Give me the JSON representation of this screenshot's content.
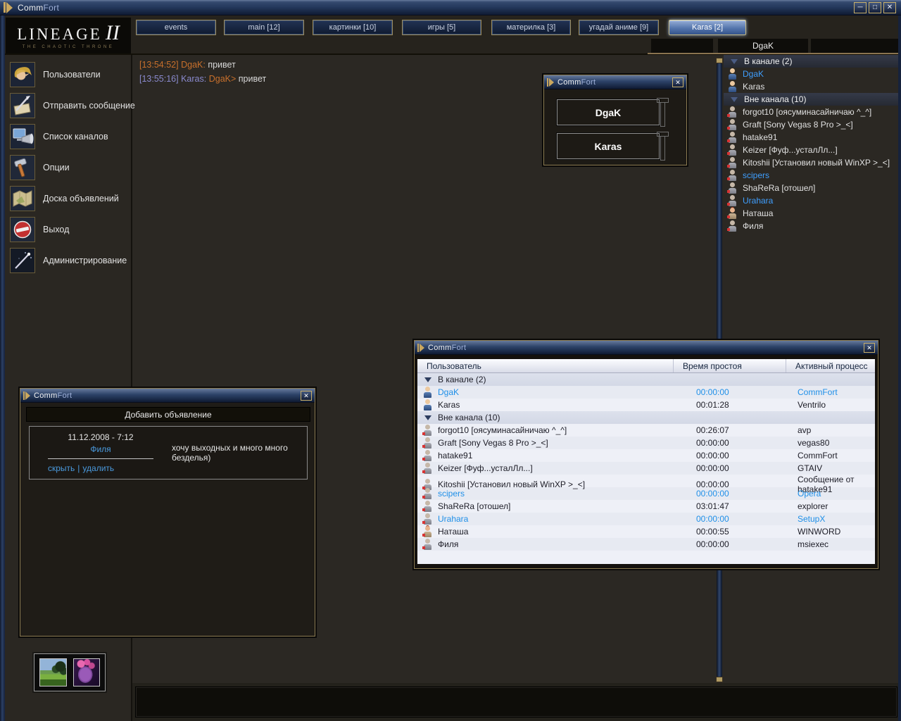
{
  "colors": {
    "accent_gold": "#b09a62",
    "titlebar_blue": "#24385c",
    "active_tab_blue": "#5576ad",
    "link_blue": "#4a9ade",
    "highlight_user_blue": "#3f9fff",
    "chat_orange": "#c8702c",
    "chat_violet": "#8a8ace",
    "table_bg": "#eef0f7"
  },
  "icons": {
    "minimize_glyph": "─",
    "maximize_glyph": "□",
    "close_glyph": "✕"
  },
  "titlebar": {
    "title_comm": "Comm",
    "title_fort": "Fort"
  },
  "logo": {
    "name": "LINEAGE",
    "numeral": "II",
    "subtitle": "THE CHAOTIC THRONE"
  },
  "tabs": [
    {
      "label": "events"
    },
    {
      "label": "main [12]"
    },
    {
      "label": "картинки [10]"
    },
    {
      "label": "игры [5]"
    },
    {
      "label": "материлка [3]"
    },
    {
      "label": "угадай аниме [9]"
    },
    {
      "label": "Karas [2]"
    }
  ],
  "user_header": {
    "current_user": "DgaK"
  },
  "sidebar": [
    {
      "label": "Пользователи",
      "icon": "users-icon"
    },
    {
      "label": "Отправить сообщение",
      "icon": "send-message-icon"
    },
    {
      "label": "Список каналов",
      "icon": "channel-list-icon"
    },
    {
      "label": "Опции",
      "icon": "options-icon"
    },
    {
      "label": "Доска объявлений",
      "icon": "bulletin-board-icon"
    },
    {
      "label": "Выход",
      "icon": "exit-icon"
    },
    {
      "label": "Администрирование",
      "icon": "administration-icon"
    }
  ],
  "chat": {
    "messages": [
      {
        "time": "[13:54:52]",
        "author": "DgaK:",
        "text": "привет"
      },
      {
        "time": "[13:55:16]",
        "author": "Karas:",
        "recipient": "DgaK>",
        "text": "привет"
      }
    ]
  },
  "userlist": {
    "items": [
      {
        "name": "В канале (2)",
        "type": "group"
      },
      {
        "name": "DgaK",
        "type": "user",
        "online": true,
        "highlight": true
      },
      {
        "name": "Karas",
        "type": "user",
        "online": true
      },
      {
        "name": "Вне канала (10)",
        "type": "group"
      },
      {
        "name": "forgot10 [оясуминасайничаю ^_^]",
        "type": "user"
      },
      {
        "name": "Graft [Sony Vegas 8 Pro >_<]",
        "type": "user"
      },
      {
        "name": "hatake91",
        "type": "user"
      },
      {
        "name": "Keizer [Фуф...усталЛл...]",
        "type": "user"
      },
      {
        "name": "Kitoshii [Установил новый WinXP >_<]",
        "type": "user"
      },
      {
        "name": "scipers",
        "type": "user",
        "highlight": true
      },
      {
        "name": "ShaReRa [отошел]",
        "type": "user"
      },
      {
        "name": "Urahara",
        "type": "user",
        "highlight": true
      },
      {
        "name": "Наташа",
        "type": "user",
        "female": true
      },
      {
        "name": "Филя",
        "type": "user"
      }
    ]
  },
  "process_window": {
    "columns": [
      "Пользователь",
      "Время простоя",
      "Активный процесс"
    ],
    "rows": [
      {
        "name": "В канале (2)",
        "idle": "",
        "process": "",
        "type": "group"
      },
      {
        "name": "DgaK",
        "idle": "00:00:00",
        "process": "CommFort",
        "highlight": true
      },
      {
        "name": "Karas",
        "idle": "00:01:28",
        "process": "Ventrilo"
      },
      {
        "name": "Вне канала (10)",
        "idle": "",
        "process": "",
        "type": "group"
      },
      {
        "name": "forgot10 [оясуминасайничаю ^_^]",
        "idle": "00:26:07",
        "process": "avp"
      },
      {
        "name": "Graft [Sony Vegas 8 Pro >_<]",
        "idle": "00:00:00",
        "process": "vegas80"
      },
      {
        "name": "hatake91",
        "idle": "00:00:00",
        "process": "CommFort"
      },
      {
        "name": "Keizer [Фуф...усталЛл...]",
        "idle": "00:00:00",
        "process": "GTAIV"
      },
      {
        "name": "Kitoshii [Установил новый WinXP >_<]",
        "idle": "00:00:00",
        "process": "Сообщение от hatake91"
      },
      {
        "name": "scipers",
        "idle": "00:00:00",
        "process": "Opera",
        "highlight": true
      },
      {
        "name": "ShaReRa [отошел]",
        "idle": "03:01:47",
        "process": "explorer"
      },
      {
        "name": "Urahara",
        "idle": "00:00:00",
        "process": "SetupX",
        "highlight": true
      },
      {
        "name": "Наташа",
        "idle": "00:00:55",
        "process": "WINWORD",
        "female": true
      },
      {
        "name": "Филя",
        "idle": "00:00:00",
        "process": "msiexec"
      }
    ]
  },
  "volume_window": {
    "user1": "DgaK",
    "user2": "Karas"
  },
  "announce_window": {
    "header": "Добавить объявление",
    "date": "11.12.2008 - 7:12",
    "author": "Филя",
    "hide_label": "скрыть",
    "separator": "|",
    "delete_label": "удалить",
    "message": "хочу выходных и много много безделья)"
  },
  "thumbnails": [
    {
      "icon": "landscape-thumbnail"
    },
    {
      "icon": "creature-thumbnail"
    }
  ]
}
